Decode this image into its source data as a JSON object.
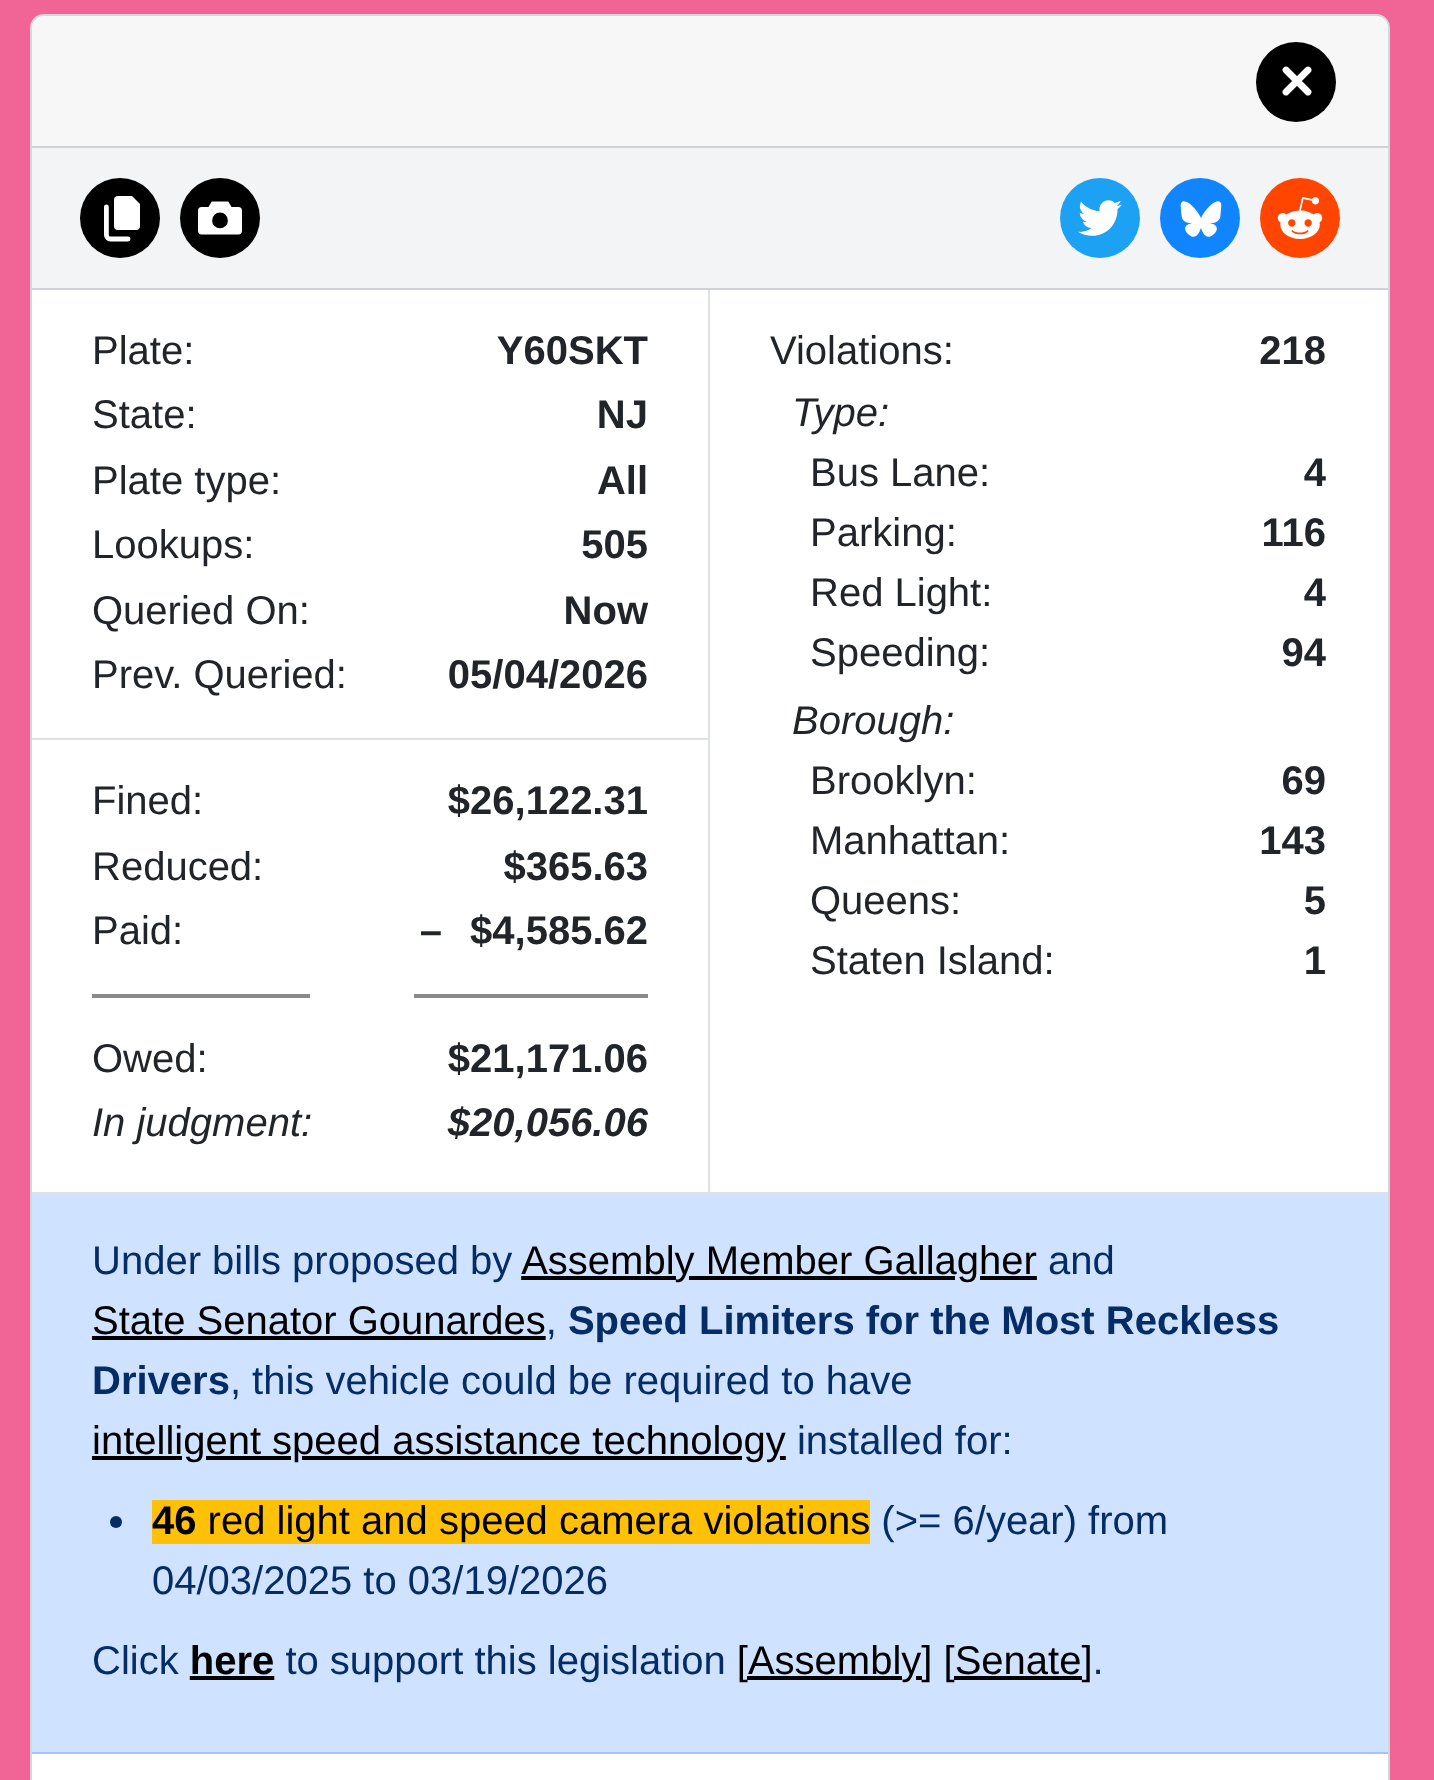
{
  "plate": [
    {
      "label": "Plate:",
      "value": "Y60SKT"
    },
    {
      "label": "State:",
      "value": "NJ"
    },
    {
      "label": "Plate type:",
      "value": "All"
    },
    {
      "label": "Lookups:",
      "value": "505"
    },
    {
      "label": "Queried On:",
      "value": "Now"
    },
    {
      "label": "Prev. Queried:",
      "value": "05/04/2026"
    }
  ],
  "fines": {
    "items": [
      {
        "label": "Fined:",
        "value": "$26,122.31"
      },
      {
        "label": "Reduced:",
        "value": "$365.63"
      },
      {
        "label": "Paid:",
        "sign": "–",
        "value": "$4,585.62"
      }
    ],
    "totals": [
      {
        "kind": "total",
        "label": "Owed:",
        "value": "$21,171.06"
      },
      {
        "kind": "judgment",
        "label": "In judgment:",
        "value": "$20,056.06"
      }
    ]
  },
  "violations": {
    "label": "Violations:",
    "value": "218",
    "groups": [
      {
        "title": "Type:",
        "items": [
          {
            "label": "Bus Lane:",
            "value": "4"
          },
          {
            "label": "Parking:",
            "value": "116"
          },
          {
            "label": "Red Light:",
            "value": "4"
          },
          {
            "label": "Speeding:",
            "value": "94"
          }
        ]
      },
      {
        "title": "Borough:",
        "items": [
          {
            "label": "Brooklyn:",
            "value": "69"
          },
          {
            "label": "Manhattan:",
            "value": "143"
          },
          {
            "label": "Queens:",
            "value": "5"
          },
          {
            "label": "Staten Island:",
            "value": "1"
          }
        ]
      }
    ]
  },
  "notice": {
    "paragraph": [
      {
        "kind": "text",
        "text": "Under bills proposed by "
      },
      {
        "kind": "link",
        "text": "Assembly Member Gallagher"
      },
      {
        "kind": "text",
        "text": " and "
      },
      {
        "kind": "link",
        "text": "State Senator Gounardes"
      },
      {
        "kind": "text",
        "text": ", "
      },
      {
        "kind": "strong",
        "text": "Speed Limiters for the Most Reckless Drivers"
      },
      {
        "kind": "text",
        "text": ", this vehicle could be required to have "
      },
      {
        "kind": "link",
        "text": "intelligent speed assistance technology"
      },
      {
        "kind": "text",
        "text": " installed for:"
      }
    ],
    "list": [
      [
        {
          "kind": "highlight",
          "text": "**46** red light and speed camera violations"
        },
        {
          "kind": "text",
          "text": " (>= 6/year) from 04/03/2025 to 03/19/2026"
        }
      ]
    ],
    "closing": [
      {
        "kind": "text",
        "text": "Click "
      },
      {
        "kind": "action",
        "text": "here"
      },
      {
        "kind": "text",
        "text": " to support this legislation "
      },
      {
        "kind": "link",
        "text": "[Assembly]"
      },
      {
        "kind": "link",
        "text": "[Senate]"
      },
      {
        "kind": "text",
        "text": "."
      }
    ]
  }
}
